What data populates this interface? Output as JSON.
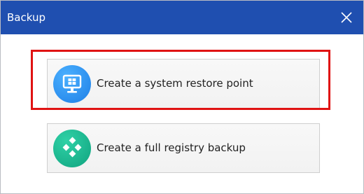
{
  "window": {
    "title": "Backup",
    "close_icon": "close-icon"
  },
  "options": [
    {
      "label": "Create a system restore point",
      "icon": "monitor-windows-icon",
      "highlighted": true
    },
    {
      "label": "Create a full registry backup",
      "icon": "registry-cubes-icon",
      "highlighted": false
    }
  ],
  "colors": {
    "titlebar": "#1f4fb0",
    "highlight": "#e01313",
    "restore_icon": "#1e7fe6",
    "registry_icon": "#10a37f"
  }
}
